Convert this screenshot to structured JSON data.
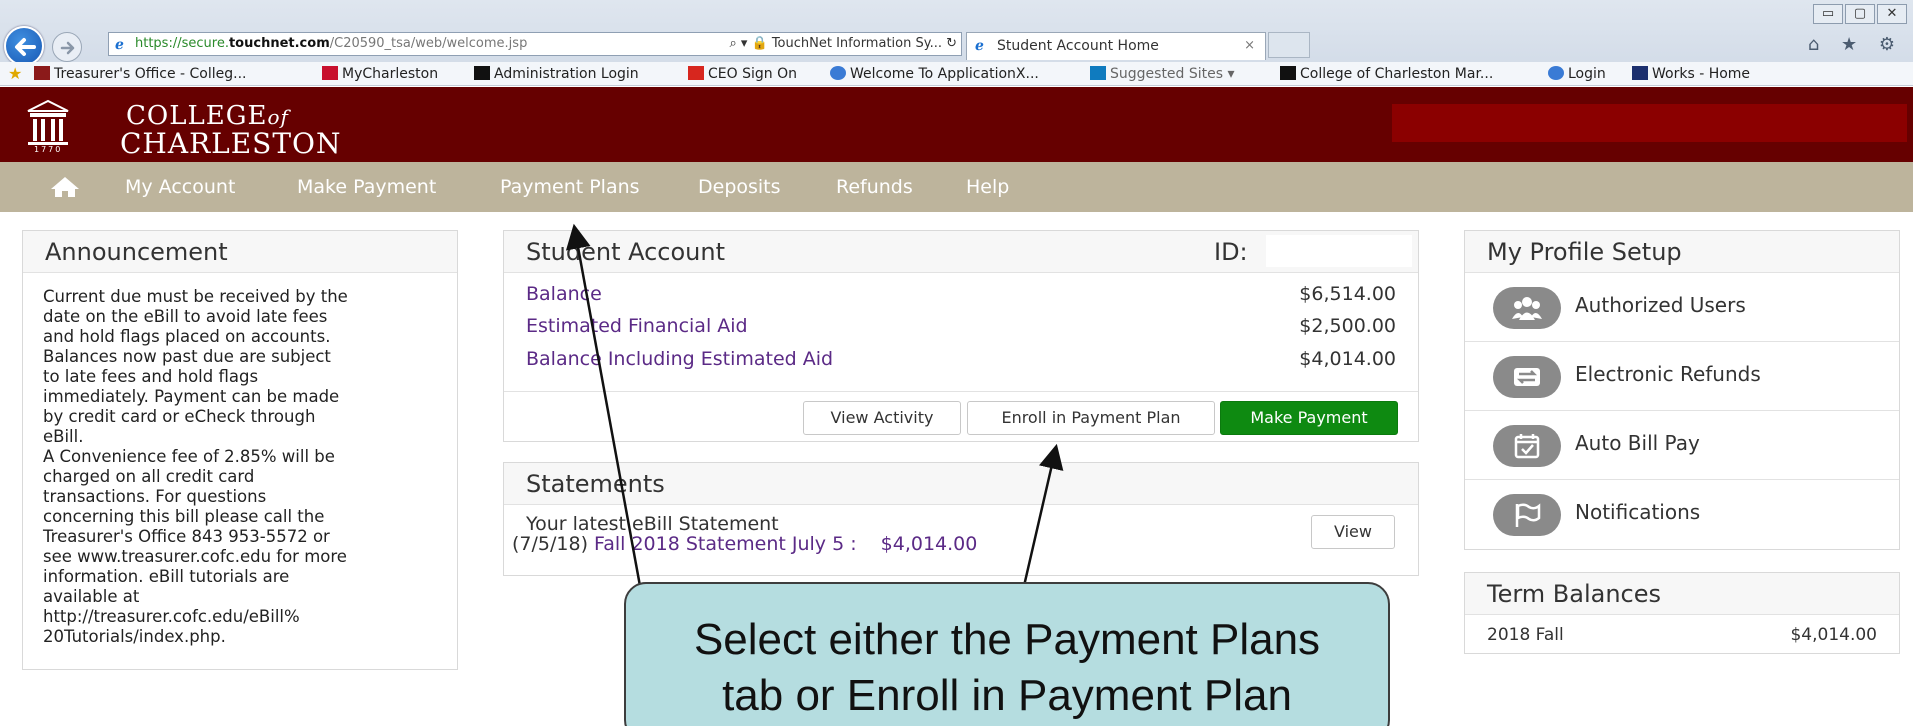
{
  "browser": {
    "url_scheme": "https://",
    "url_sub": "secure.",
    "url_domain": "touchnet.com",
    "url_path": "/C20590_tsa/web/welcome.jsp",
    "address_tools": "⌕ ▾  🔒 TouchNet Information Sy... ↻",
    "tab_title": "Student Account Home",
    "tab_close": "×",
    "window_controls": [
      "▭",
      "▢",
      "✕"
    ],
    "toolbar_icons": "⌂ ★ ⚙"
  },
  "favorites": [
    {
      "label": "Treasurer's Office - Colleg...",
      "color": "#8b1a1a"
    },
    {
      "label": "MyCharleston",
      "color": "#c8102e"
    },
    {
      "label": "Administration Login",
      "color": "#111111"
    },
    {
      "label": "CEO Sign On",
      "color": "#d7261e"
    },
    {
      "label": "Welcome To ApplicationX...",
      "color": "#3a7bd5"
    },
    {
      "label": "Suggested Sites ▾",
      "color": "#0f7bbf"
    },
    {
      "label": "College of Charleston Mar...",
      "color": "#111111"
    },
    {
      "label": "Login",
      "color": "#3a7bd5"
    },
    {
      "label": "Works - Home",
      "color": "#1b2f6e"
    }
  ],
  "site": {
    "logo_line1": "COLLEGE",
    "logo_of": "of",
    "logo_line2": "CHARLESTON",
    "logo_year": "1770"
  },
  "nav": {
    "items": [
      "My Account",
      "Make Payment",
      "Payment Plans",
      "Deposits",
      "Refunds",
      "Help"
    ]
  },
  "announcement": {
    "title": "Announcement",
    "lines": [
      "Current due must be received by the",
      "date on the eBill to avoid late fees",
      "and hold flags placed on accounts.",
      "Balances now past due are subject",
      "to late fees and hold flags",
      "immediately. Payment can be made",
      "by credit card or eCheck through",
      "eBill.",
      "A Convenience fee of 2.85% will be",
      "charged on all credit card",
      "transactions. For questions",
      "concerning this bill please call the",
      "Treasurer's Office 843 953-5572 or",
      "see www.treasurer.cofc.edu for more",
      "information. eBill tutorials are",
      "available at",
      "http://treasurer.cofc.edu/eBill%",
      "20Tutorials/index.php."
    ]
  },
  "student_account": {
    "title": "Student Account",
    "id_label": "ID:",
    "rows": [
      {
        "label": "Balance",
        "value": "$6,514.00"
      },
      {
        "label": "Estimated Financial Aid",
        "value": "$2,500.00"
      },
      {
        "label": "Balance Including Estimated Aid",
        "value": "$4,014.00"
      }
    ],
    "buttons": {
      "view_activity": "View Activity",
      "enroll": "Enroll in Payment Plan",
      "make_payment": "Make Payment"
    }
  },
  "statements": {
    "title": "Statements",
    "line1": "Your latest eBill Statement",
    "date": "(7/5/18)",
    "statement_name": "Fall 2018 Statement July 5 :",
    "amount": "$4,014.00",
    "view_label": "View"
  },
  "profile": {
    "title": "My Profile Setup",
    "items": [
      "Authorized Users",
      "Electronic Refunds",
      "Auto Bill Pay",
      "Notifications"
    ]
  },
  "term_balances": {
    "title": "Term Balances",
    "term": "2018 Fall",
    "amount": "$4,014.00"
  },
  "callout": {
    "line1": "Select either the Payment Plans",
    "line2": "tab or Enroll in Payment Plan"
  }
}
